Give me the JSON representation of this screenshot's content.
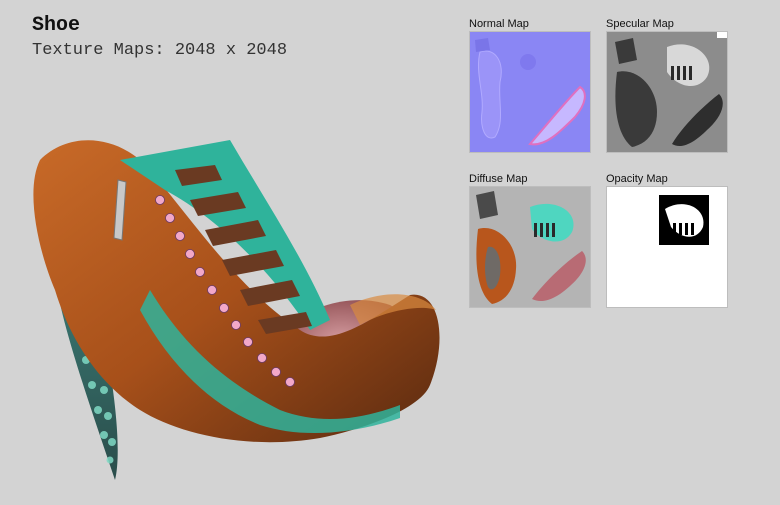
{
  "header": {
    "title": "Shoe",
    "subtitle": "Texture Maps: 2048 x 2048"
  },
  "maps": [
    {
      "label": "Normal Map",
      "icon": "normal-map-texture",
      "color": "#8a86f4"
    },
    {
      "label": "Specular Map",
      "icon": "specular-map-texture",
      "color": "#8c8c8c"
    },
    {
      "label": "Diffuse Map",
      "icon": "diffuse-map-texture",
      "color": "#b4b4b4"
    },
    {
      "label": "Opacity Map",
      "icon": "opacity-map-texture",
      "color": "#ffffff"
    }
  ],
  "render": {
    "icon": "shoe-render",
    "colors": {
      "leather": "#b4561c",
      "teal": "#2fb39b",
      "lining": "#b56a6e",
      "background": "#d3d3d3"
    }
  }
}
